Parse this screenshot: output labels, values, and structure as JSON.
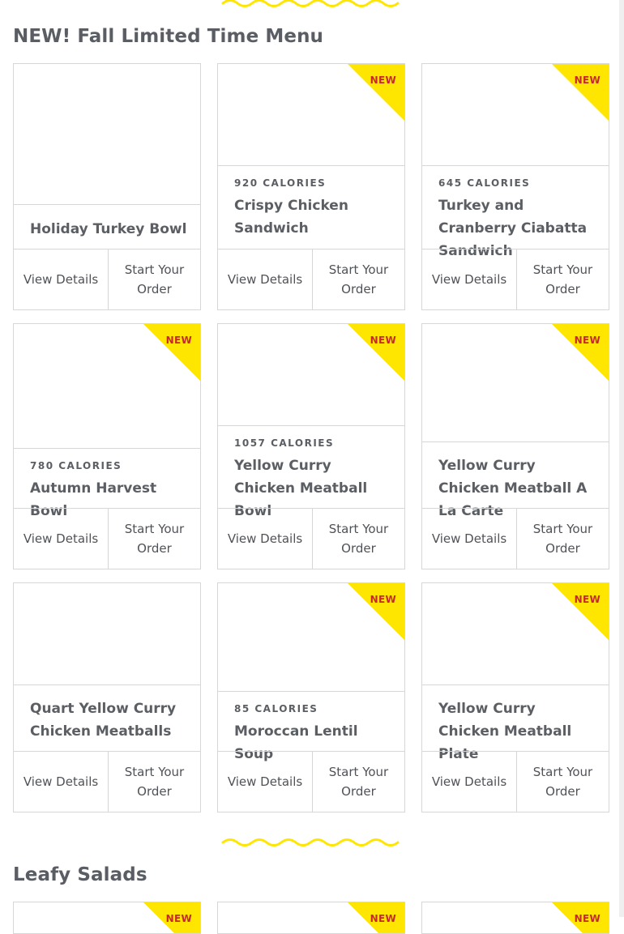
{
  "sections": [
    {
      "title": "NEW! Fall Limited Time Menu",
      "items": [
        {
          "name": "Holiday Turkey Bowl",
          "calories": "",
          "is_new": false
        },
        {
          "name": "Crispy Chicken Sandwich",
          "calories": "920 CALORIES",
          "is_new": true
        },
        {
          "name": "Turkey and Cranberry Ciabatta Sandwich",
          "calories": "645 CALORIES",
          "is_new": true
        },
        {
          "name": "Autumn Harvest Bowl",
          "calories": "780 CALORIES",
          "is_new": true
        },
        {
          "name": "Yellow Curry Chicken Meatball Bowl",
          "calories": "1057 CALORIES",
          "is_new": true
        },
        {
          "name": "Yellow Curry Chicken Meatball A La Carte",
          "calories": "",
          "is_new": true
        },
        {
          "name": "Quart Yellow Curry Chicken Meatballs",
          "calories": "",
          "is_new": false
        },
        {
          "name": "Moroccan Lentil Soup",
          "calories": "85 CALORIES",
          "is_new": true
        },
        {
          "name": "Yellow Curry Chicken Meatball Plate",
          "calories": "",
          "is_new": true
        }
      ]
    },
    {
      "title": "Leafy Salads",
      "items": [
        {
          "name": "",
          "calories": "",
          "is_new": true
        },
        {
          "name": "",
          "calories": "",
          "is_new": true
        },
        {
          "name": "",
          "calories": "",
          "is_new": true
        }
      ]
    }
  ],
  "labels": {
    "new_badge": "NEW",
    "view_details": "View Details",
    "start_order": "Start Your Order"
  },
  "colors": {
    "accent_yellow": "#ffe600",
    "badge_text": "#c7282e",
    "text": "#5b5e63",
    "border": "#d7d7d7"
  }
}
